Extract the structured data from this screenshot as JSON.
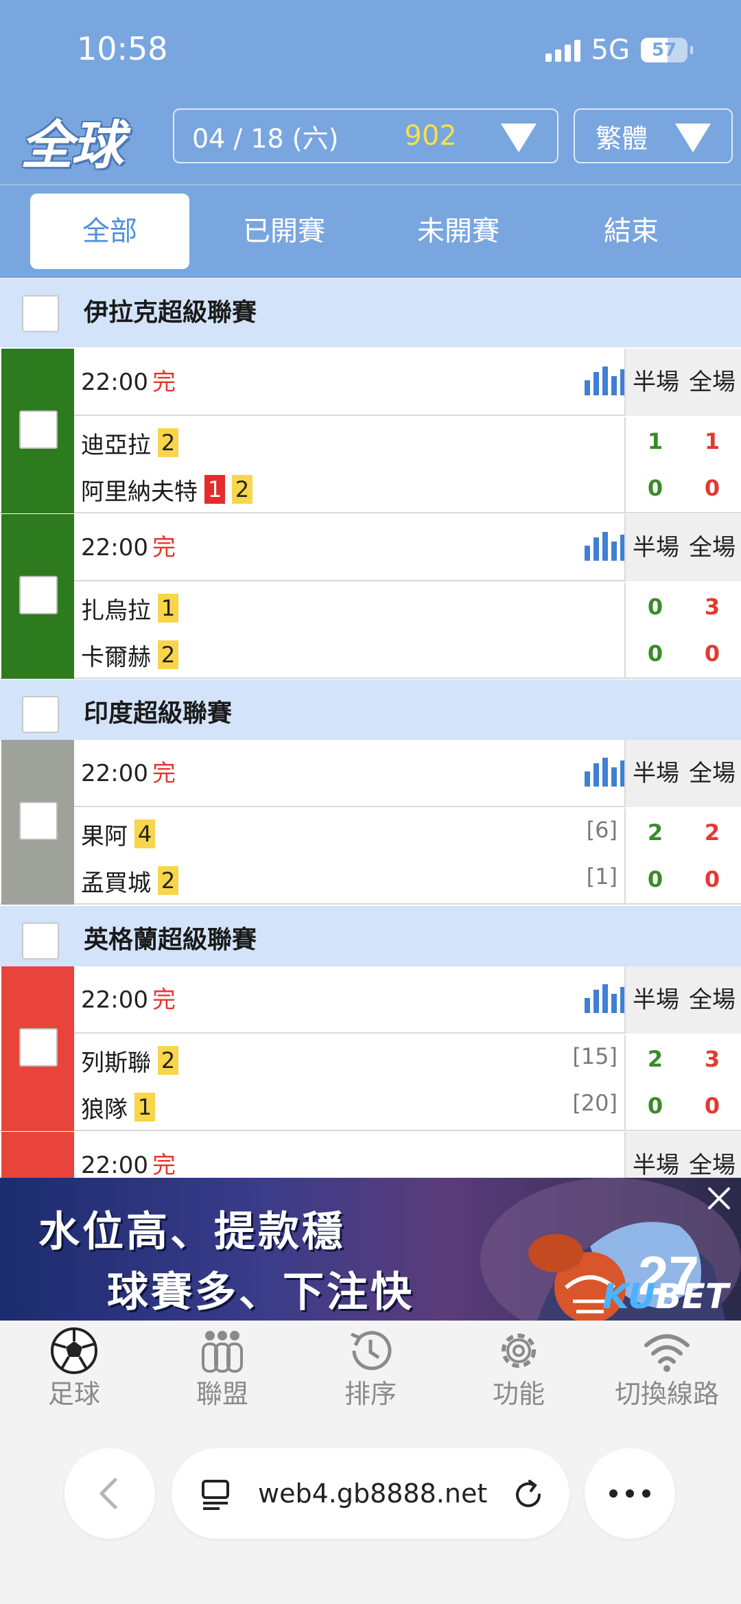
{
  "status_bar": {
    "time": "10:58",
    "network": "5G",
    "battery": "57"
  },
  "header": {
    "logo": "全球",
    "date": "04 / 18 (六)",
    "match_count": "902",
    "language": "繁體"
  },
  "tabs": [
    {
      "label": "全部",
      "active": true
    },
    {
      "label": "已開賽",
      "active": false
    },
    {
      "label": "未開賽",
      "active": false
    },
    {
      "label": "結束",
      "active": false
    }
  ],
  "score_headers": {
    "half": "半場",
    "full": "全場"
  },
  "leagues": [
    {
      "name": "伊拉克超級聯賽",
      "color": "#2e7a1e",
      "matches": [
        {
          "time": "22:00",
          "status": "完",
          "home": {
            "name": "迪亞拉",
            "yellow": "2"
          },
          "away": {
            "name": "阿里納夫特",
            "red": "1",
            "yellow": "2"
          },
          "half": [
            "1",
            "0"
          ],
          "full": [
            "1",
            "0"
          ]
        },
        {
          "time": "22:00",
          "status": "完",
          "home": {
            "name": "扎烏拉",
            "yellow": "1"
          },
          "away": {
            "name": "卡爾赫",
            "yellow": "2"
          },
          "half": [
            "0",
            "0"
          ],
          "full": [
            "3",
            "0"
          ]
        }
      ]
    },
    {
      "name": "印度超級聯賽",
      "color": "#9ea29b",
      "matches": [
        {
          "time": "22:00",
          "status": "完",
          "home": {
            "name": "果阿",
            "yellow": "4",
            "rank": "[6]"
          },
          "away": {
            "name": "孟買城",
            "yellow": "2",
            "rank": "[1]"
          },
          "half": [
            "2",
            "0"
          ],
          "full": [
            "2",
            "0"
          ]
        }
      ]
    },
    {
      "name": "英格蘭超級聯賽",
      "color": "#e8443c",
      "matches": [
        {
          "time": "22:00",
          "status": "完",
          "home": {
            "name": "列斯聯",
            "yellow": "2",
            "rank": "[15]"
          },
          "away": {
            "name": "狼隊",
            "yellow": "1",
            "rank": "[20]"
          },
          "half": [
            "2",
            "0"
          ],
          "full": [
            "3",
            "0"
          ]
        },
        {
          "time": "22:00",
          "status": "完"
        }
      ]
    }
  ],
  "ad": {
    "line1": "水位高、提款穩",
    "line2": "球賽多、下注快",
    "brand_ku": "KU",
    "brand_bet": "BET"
  },
  "bottom_nav": [
    {
      "label": "足球",
      "icon": "soccer-ball-icon"
    },
    {
      "label": "聯盟",
      "icon": "league-icon"
    },
    {
      "label": "排序",
      "icon": "history-sort-icon"
    },
    {
      "label": "功能",
      "icon": "gear-icon"
    },
    {
      "label": "切換線路",
      "icon": "wifi-icon"
    }
  ],
  "browser": {
    "url": "web4.gb8888.net"
  }
}
